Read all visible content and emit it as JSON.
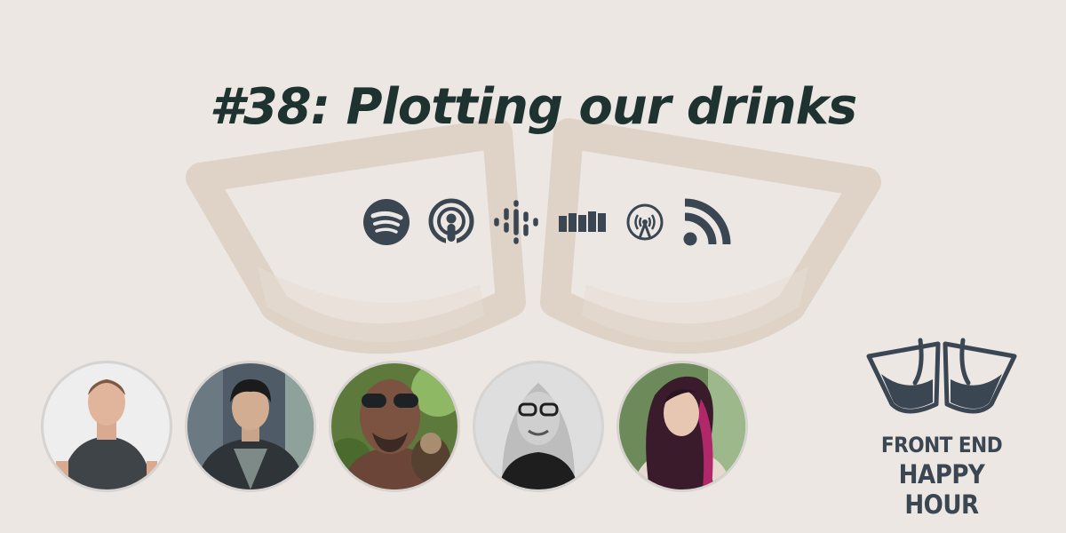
{
  "episode": {
    "title": "#38: Plotting our drinks"
  },
  "colors": {
    "background": "#ede7e3",
    "title": "#1e3330",
    "icon": "#3a4652",
    "watermark": "#dfd3c7"
  },
  "platforms": [
    {
      "name": "Spotify",
      "icon": "spotify-icon"
    },
    {
      "name": "Apple Podcasts",
      "icon": "apple-podcasts-icon"
    },
    {
      "name": "Google Podcasts",
      "icon": "google-podcasts-icon"
    },
    {
      "name": "Stitcher",
      "icon": "stitcher-icon"
    },
    {
      "name": "Overcast",
      "icon": "overcast-icon"
    },
    {
      "name": "RSS",
      "icon": "rss-icon"
    }
  ],
  "hosts": [
    {
      "icon": "host-photo-1"
    },
    {
      "icon": "host-photo-2"
    },
    {
      "icon": "host-photo-3"
    },
    {
      "icon": "host-photo-4"
    },
    {
      "icon": "host-photo-5"
    }
  ],
  "logo": {
    "line1": "FRONT END",
    "line2": "HAPPY HOUR"
  }
}
